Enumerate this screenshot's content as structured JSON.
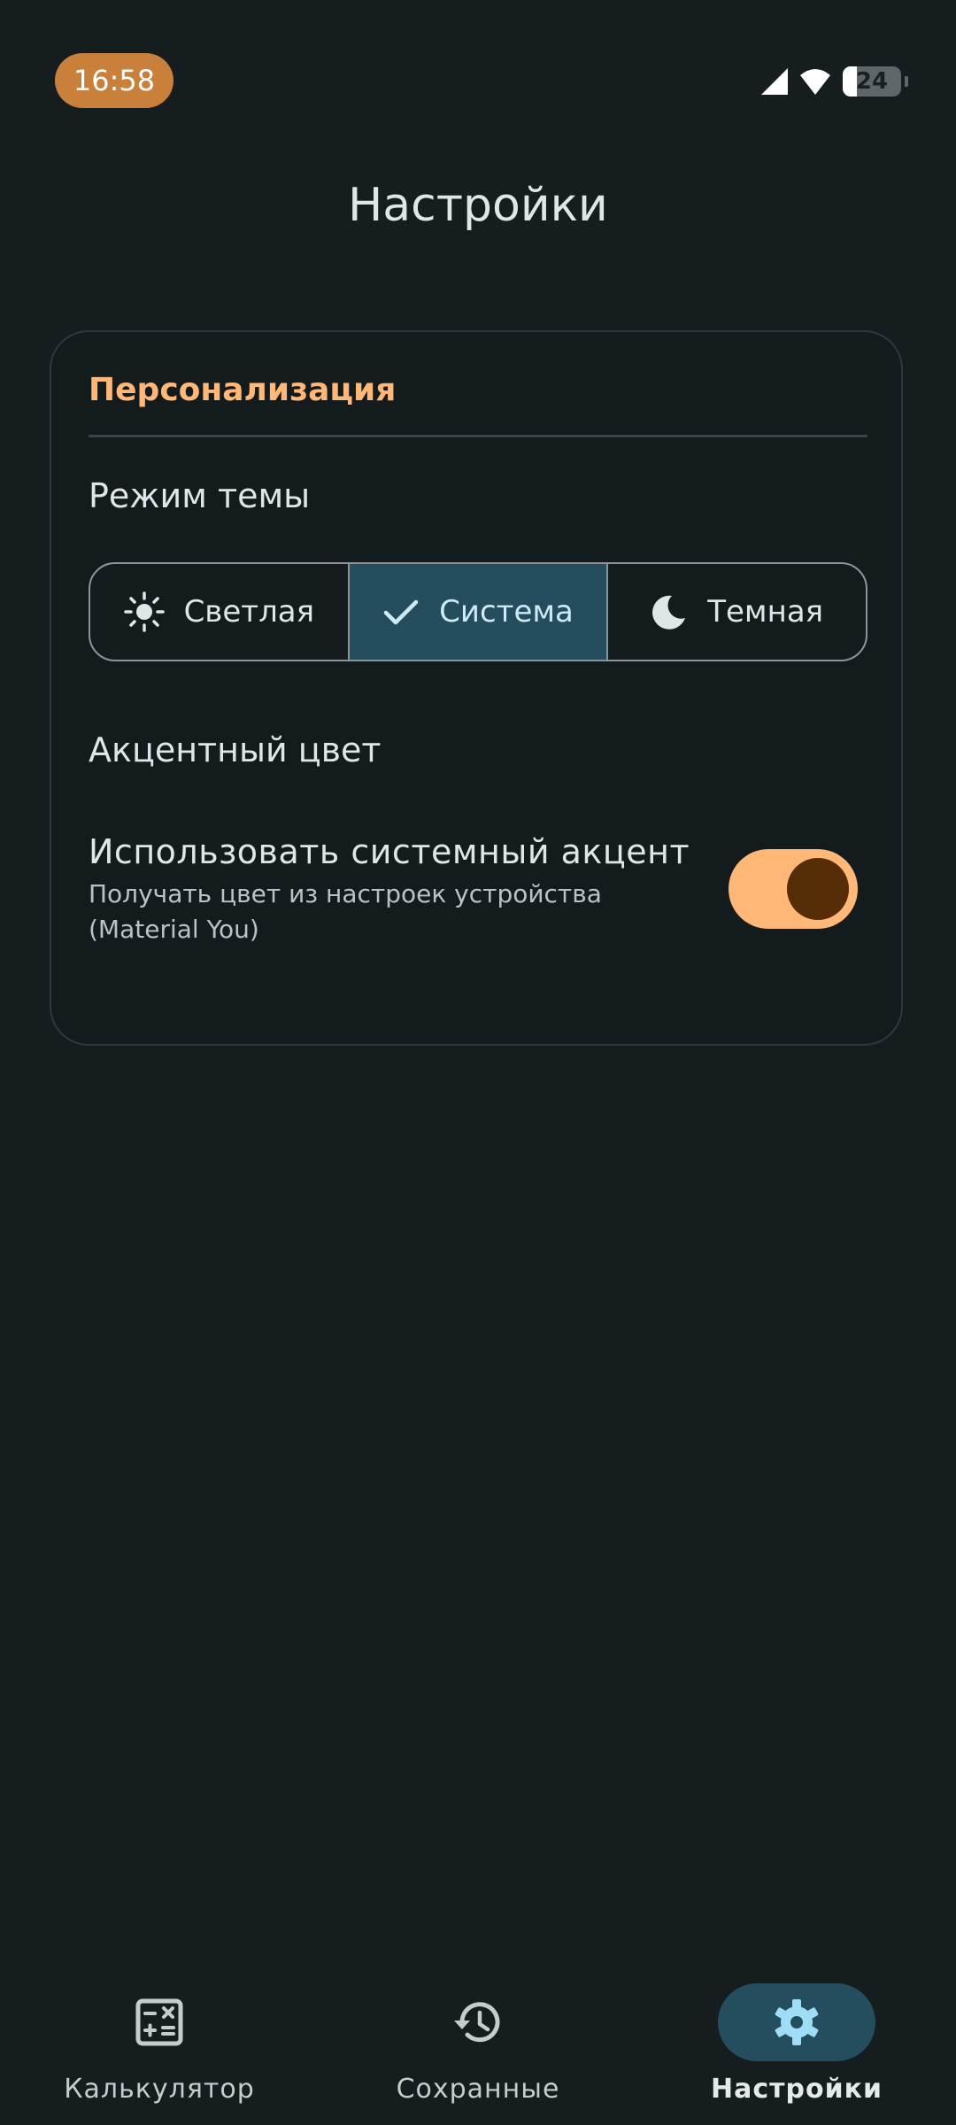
{
  "status_bar": {
    "time": "16:58",
    "battery": "24"
  },
  "header": {
    "title": "Настройки"
  },
  "card": {
    "section_title": "Персонализация",
    "theme_mode_label": "Режим темы",
    "theme_options": [
      {
        "label": "Светлая",
        "icon": "sun-icon",
        "selected": false
      },
      {
        "label": "Система",
        "icon": "check-icon",
        "selected": true
      },
      {
        "label": "Темная",
        "icon": "moon-icon",
        "selected": false
      }
    ],
    "accent_label": "Акцентный цвет",
    "system_accent": {
      "title": "Использовать системный акцент",
      "subtitle": "Получать цвет из настроек устройства (Material You)",
      "enabled": true
    }
  },
  "bottom_nav": [
    {
      "label": "Калькулятор",
      "icon": "calculator-icon",
      "active": false
    },
    {
      "label": "Сохранные",
      "icon": "history-icon",
      "active": false
    },
    {
      "label": "Настройки",
      "icon": "gear-icon",
      "active": true
    }
  ],
  "colors": {
    "background": "#151d1f",
    "accent": "#ffb877",
    "selected_segment": "#244d5e",
    "time_pill": "#c8803b"
  }
}
